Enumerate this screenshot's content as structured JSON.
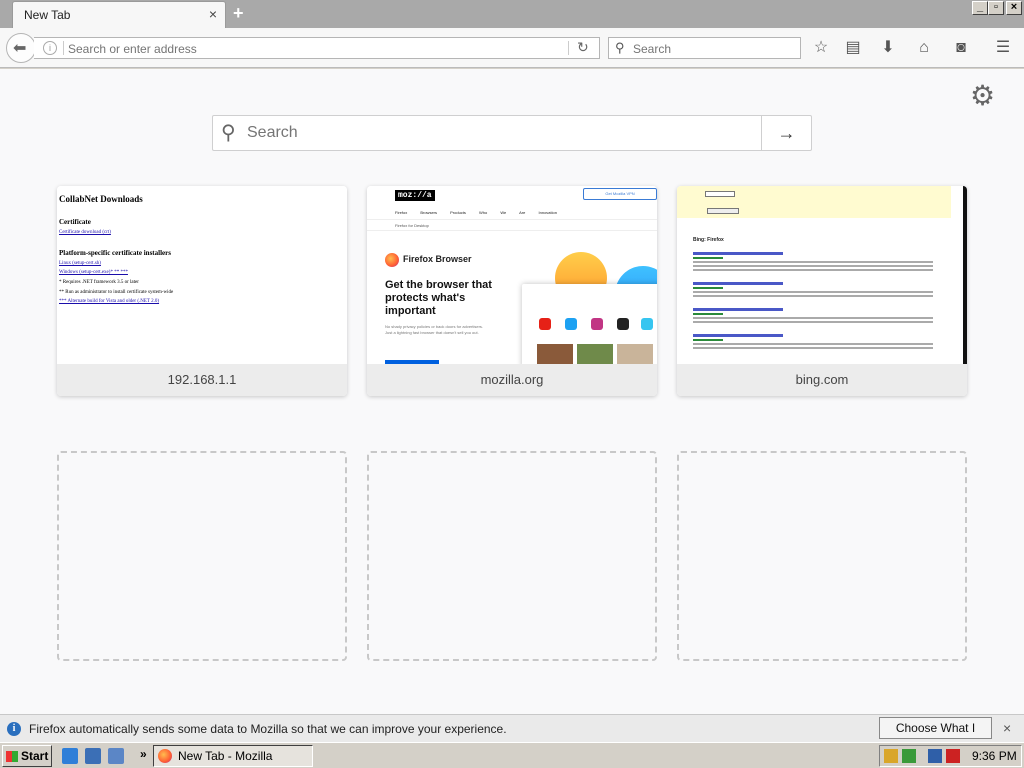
{
  "tab": {
    "title": "New Tab",
    "close": "×",
    "new_tab": "+"
  },
  "window_controls": {
    "minimize": "_",
    "restore": "▫",
    "close": "×"
  },
  "navbar": {
    "url_placeholder": "Search or enter address",
    "search_placeholder": "Search"
  },
  "newtab": {
    "search_placeholder": "Search",
    "go": "→",
    "tiles": [
      {
        "label": "192.168.1.1"
      },
      {
        "label": "mozilla.org"
      },
      {
        "label": "bing.com"
      }
    ],
    "tile1": {
      "title": "CollabNet Downloads",
      "h_certificate": "Certificate",
      "l_certificate": "Certificate download (crt)",
      "h_platform": "Platform-specific certificate installers",
      "l_linux": "Linux (setup-cert.sh)",
      "l_windows": "Windows (setup-cert.exe)* ** ***",
      "t_net": "* Requires .NET framework 3.5 or later",
      "t_admin": "** Run as administrator to install certificate system-wide",
      "l_alt": "*** Alternate build for Vista and older (.NET 2.0)"
    },
    "tile2": {
      "logo": "moz://a",
      "download": "Get Mozilla VPN",
      "nav": "Firefox Browsers Products Who We Are Innovation",
      "subnav": "Firefox for Desktop",
      "brand": "Firefox Browser",
      "headline": "Get the browser that protects what's important",
      "para": "No shady privacy policies or back doors for advertisers. Just a lightning fast browser that doesn't sell you out."
    },
    "tile3": {
      "title": "Bing: Firefox"
    }
  },
  "notification": {
    "message": "Firefox automatically sends some data to Mozilla so that we can improve your experience.",
    "button": "Choose What I Share",
    "close": "×"
  },
  "taskbar": {
    "start": "Start",
    "chevron": "»",
    "task": "New Tab - Mozilla Firefox",
    "clock": "9:36 PM"
  }
}
